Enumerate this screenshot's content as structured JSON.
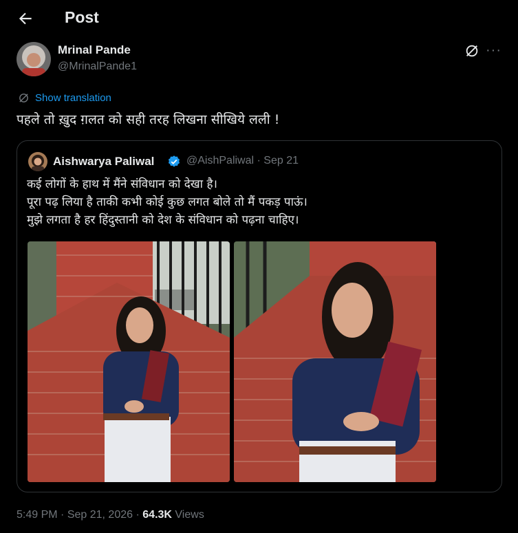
{
  "header": {
    "title": "Post"
  },
  "author": {
    "name": "Mrinal Pande",
    "handle": "@MrinalPande1"
  },
  "translation": {
    "label": "Show translation"
  },
  "tweet": {
    "text": "पहले तो ख़ुद ग़लत को सही तरह लिखना सीखिये लली !"
  },
  "quote": {
    "name": "Aishwarya Paliwal",
    "handle": "@AishPaliwal",
    "separator": "·",
    "date": "Sep 21",
    "lines": [
      "कई लोगों के हाथ में मैंने संविधान को देखा है।",
      "पूरा पढ़ लिया है ताकी कभी कोई कुछ लगत बोले तो मैं पकड़ पाऊं।",
      "मुझे लगता है हर हिंदुस्तानी को देश के संविधान को पढ़ना चाहिए।"
    ]
  },
  "meta": {
    "time": "5:49 PM",
    "dot": "·",
    "date": "Sep 21, 2026",
    "views_count": "64.3K",
    "views_label": "Views"
  },
  "colors": {
    "background": "#000000",
    "text": "#e7e9ea",
    "secondary": "#71767b",
    "link": "#1d9bf0",
    "border": "#2f3336",
    "verified": "#1d9bf0"
  }
}
